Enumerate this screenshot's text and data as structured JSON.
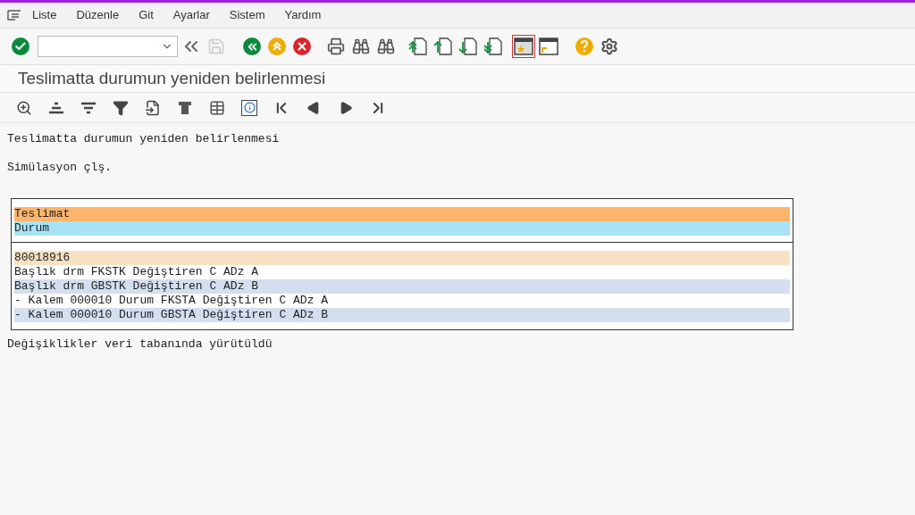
{
  "menu": [
    "Liste",
    "Düzenle",
    "Git",
    "Ayarlar",
    "Sistem",
    "Yardım"
  ],
  "title": "Teslimatta durumun yeniden belirlenmesi",
  "lines_before": [
    "Teslimatta durumun yeniden belirlenmesi",
    "Simülasyon çlş."
  ],
  "header_rows": [
    {
      "kind": "primary",
      "text": "Teslimat"
    },
    {
      "kind": "secondary",
      "text": "Durum"
    }
  ],
  "rows": [
    {
      "kind": "key",
      "text": "80018916"
    },
    {
      "kind": "plain",
      "text": "Başlık drm FKSTK Değiştiren C ADz A"
    },
    {
      "kind": "alt",
      "text": "Başlık drm GBSTK Değiştiren C ADz B"
    },
    {
      "kind": "plain",
      "text": "- Kalem 000010 Durum FKSTA Değiştiren C ADz A"
    },
    {
      "kind": "alt",
      "text": "- Kalem 000010 Durum GBSTA Değiştiren C ADz B"
    }
  ],
  "lines_after": [
    "Değişiklikler veri tabanında yürütüldü"
  ]
}
